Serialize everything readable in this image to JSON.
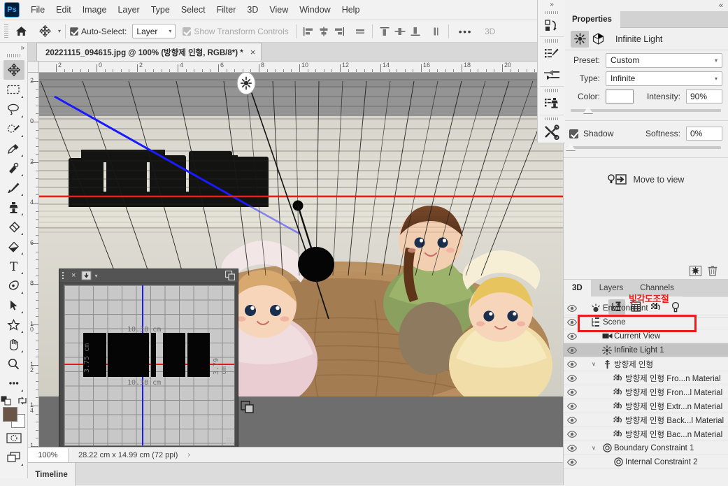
{
  "app": {
    "logo": "Ps",
    "menus": [
      "File",
      "Edit",
      "Image",
      "Layer",
      "Type",
      "Select",
      "Filter",
      "3D",
      "View",
      "Window",
      "Help"
    ]
  },
  "options_bar": {
    "home_icon": "home-icon",
    "tool_icon": "move-tool-icon",
    "auto_select_label": "Auto-Select:",
    "auto_select_checked": true,
    "auto_select_value": "Layer",
    "show_transform_label": "Show Transform Controls",
    "show_transform_checked": true,
    "more_label": "•••",
    "mode_3d_label": "3D"
  },
  "toolbar": {
    "expand_label": "»",
    "tools": [
      {
        "name": "move-tool",
        "active": true
      },
      {
        "name": "rectangular-marquee-tool",
        "active": false
      },
      {
        "name": "lasso-tool",
        "active": false
      },
      {
        "name": "quick-selection-tool",
        "active": false
      },
      {
        "name": "crop-tool",
        "active": false
      },
      {
        "name": "eyedropper-tool",
        "active": false
      },
      {
        "name": "spot-healing-brush-tool",
        "active": false
      },
      {
        "name": "brush-tool",
        "active": false
      },
      {
        "name": "clone-stamp-tool",
        "active": false
      },
      {
        "name": "eraser-tool",
        "active": false
      },
      {
        "name": "gradient-tool",
        "active": false
      },
      {
        "name": "type-tool",
        "active": false
      },
      {
        "name": "pen-tool",
        "active": false
      },
      {
        "name": "path-selection-tool",
        "active": false
      },
      {
        "name": "custom-shape-tool",
        "active": false
      },
      {
        "name": "hand-tool",
        "active": false
      },
      {
        "name": "zoom-tool",
        "active": false
      },
      {
        "name": "edit-toolbar-tool",
        "active": false
      }
    ],
    "foreground_color": "#6b5546",
    "background_color": "#ffffff",
    "quick_mask_name": "quick-mask-mode",
    "screen_mode_name": "screen-mode"
  },
  "document": {
    "tab_title": "20221115_094615.jpg @ 100% (방향제 인형, RGB/8*) *",
    "close_label": "×"
  },
  "rulers": {
    "unit": "cm",
    "horizontal_ticks": [
      "2",
      "0",
      "2",
      "4",
      "6",
      "8",
      "10",
      "12",
      "14",
      "16",
      "18",
      "20"
    ],
    "vertical_ticks": [
      "2",
      "0",
      "2",
      "4",
      "6",
      "8",
      "10",
      "12",
      "14",
      "16"
    ]
  },
  "mesh_panel": {
    "close_label": "×",
    "menu_icon": "panel-menu-icon",
    "preset_icon": "preset-dropdown-icon",
    "expand_icon": "expand-icon",
    "label_top": "10.38  cm",
    "label_bottom": "10.38  cm",
    "label_left": "3.75 cm",
    "label_right": "3.79 cm"
  },
  "status_bar": {
    "zoom": "100%",
    "dimensions": "28.22 cm x 14.99 cm (72 ppi)",
    "arrow": "›"
  },
  "timeline": {
    "tab_label": "Timeline"
  },
  "mini_tools": {
    "collapse_label": "»",
    "items": [
      {
        "name": "3d-material-drop-icon"
      },
      {
        "name": "3d-material-brush-icon"
      },
      {
        "name": "3d-light-slider-icon"
      },
      {
        "name": "3d-stamp-icon"
      },
      {
        "name": "3d-tools-icon"
      }
    ]
  },
  "dock": {
    "collapse_label": "«",
    "properties_tab": "Properties",
    "bottom_tabs": [
      {
        "label": "3D",
        "active": true
      },
      {
        "label": "Layers",
        "active": false
      },
      {
        "label": "Channels",
        "active": false
      }
    ]
  },
  "properties": {
    "header_icon_light": "infinite-light-icon",
    "header_icon_coordinates": "coordinates-icon",
    "title": "Infinite Light",
    "preset_label": "Preset:",
    "preset_value": "Custom",
    "type_label": "Type:",
    "type_value": "Infinite",
    "color_label": "Color:",
    "color_value": "#ffffff",
    "intensity_label": "Intensity:",
    "intensity_value": "90%",
    "intensity_slider_pct": 13,
    "shadow_label": "Shadow",
    "shadow_checked": true,
    "softness_label": "Softness:",
    "softness_value": "0%",
    "softness_slider_pct": 0,
    "move_to_view_label": "Move to view",
    "move_to_view_icon": "move-to-view-icon",
    "footer_icons": [
      {
        "name": "render-icon"
      },
      {
        "name": "delete-icon"
      }
    ]
  },
  "panel_3d": {
    "toolbar_icons": [
      {
        "name": "scene-filter-icon",
        "active": true
      },
      {
        "name": "mesh-filter-icon",
        "active": false
      },
      {
        "name": "material-filter-icon",
        "active": false
      },
      {
        "name": "light-filter-icon",
        "active": false
      }
    ],
    "annotation": "빛각도조절",
    "annotation_color": "#e81d1d",
    "rows": [
      {
        "name": "Environment",
        "icon": "environment-icon",
        "indent": 0,
        "selected": false,
        "arrow": ""
      },
      {
        "name": "Scene",
        "icon": "scene-icon",
        "indent": 0,
        "selected": false,
        "arrow": ""
      },
      {
        "name": "Current View",
        "icon": "camera-icon",
        "indent": 1,
        "selected": false,
        "arrow": ""
      },
      {
        "name": "Infinite Light 1",
        "icon": "light-icon",
        "indent": 1,
        "selected": true,
        "arrow": ""
      },
      {
        "name": "방향제 인형",
        "icon": "mesh-icon",
        "indent": 1,
        "selected": false,
        "arrow": "∨"
      },
      {
        "name": "방향제 인형 Fro...n Material",
        "icon": "material-icon",
        "indent": 2,
        "selected": false,
        "arrow": ""
      },
      {
        "name": "방향제 인형 Fron...l Material",
        "icon": "material-icon",
        "indent": 2,
        "selected": false,
        "arrow": ""
      },
      {
        "name": "방향제 인형 Extr...n Material",
        "icon": "material-icon",
        "indent": 2,
        "selected": false,
        "arrow": ""
      },
      {
        "name": "방향제 인형 Back...l Material",
        "icon": "material-icon",
        "indent": 2,
        "selected": false,
        "arrow": ""
      },
      {
        "name": "방향제 인형 Bac...n Material",
        "icon": "material-icon",
        "indent": 2,
        "selected": false,
        "arrow": ""
      },
      {
        "name": "Boundary Constraint 1",
        "icon": "constraint-icon",
        "indent": 1,
        "selected": false,
        "arrow": "∨"
      },
      {
        "name": "Internal Constraint 2",
        "icon": "constraint-icon",
        "indent": 2,
        "selected": false,
        "arrow": ""
      }
    ]
  },
  "canvas": {
    "light_widget_name": "infinite-light-widget",
    "light_handle_name": "light-direction-handle",
    "horizon_line_color": "#e81d1d",
    "perspective_line_color": "#1a1aff",
    "text_3d_content": "방향제 인형"
  }
}
